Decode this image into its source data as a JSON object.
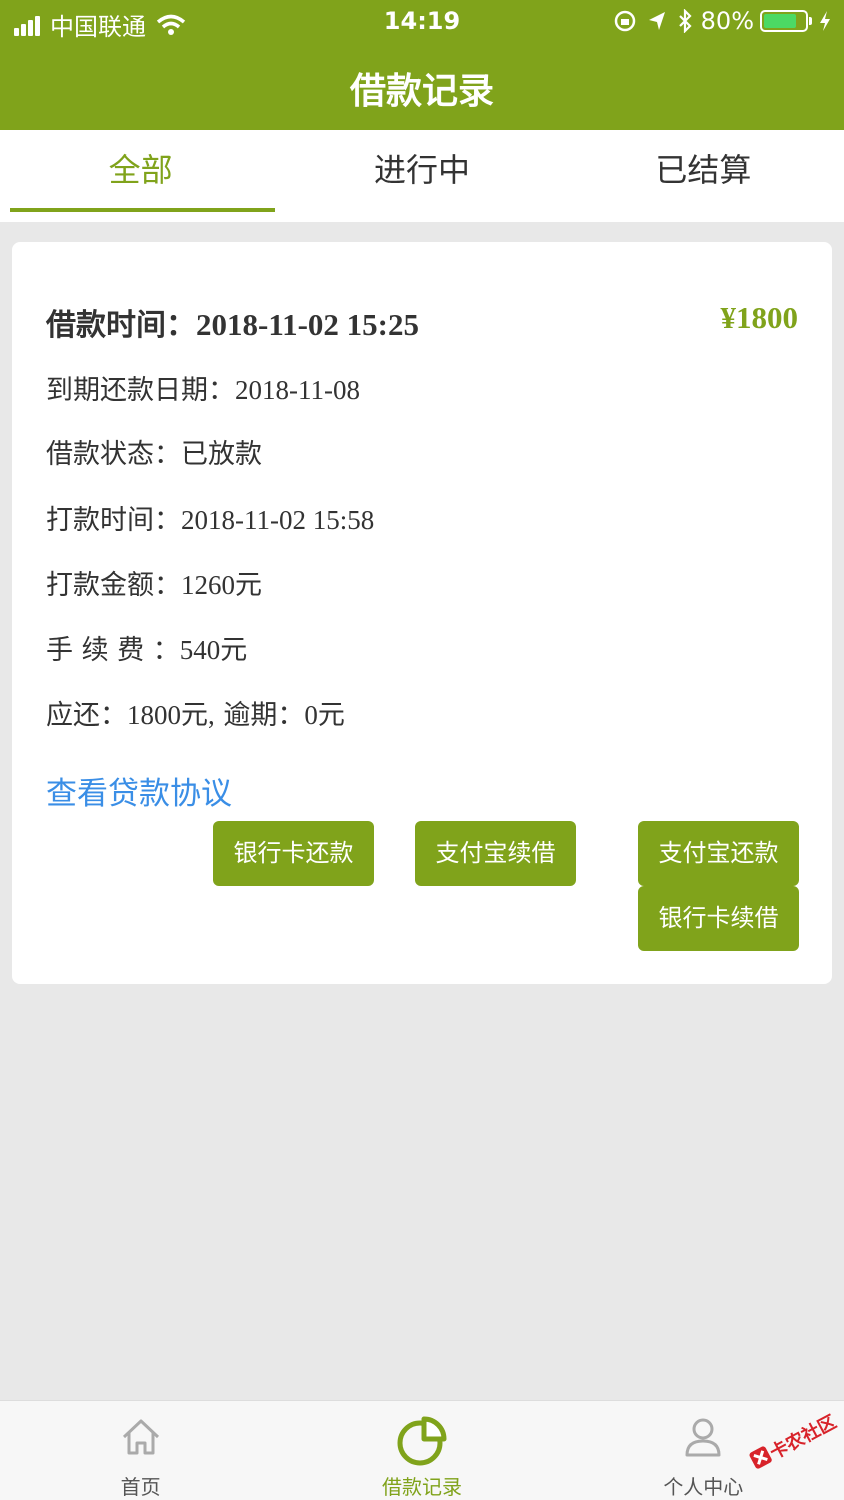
{
  "status_bar": {
    "carrier": "中国联通",
    "time": "14:19",
    "battery": "80%"
  },
  "header": {
    "title": "借款记录"
  },
  "tabs": [
    {
      "label": "全部",
      "active": true
    },
    {
      "label": "进行中",
      "active": false
    },
    {
      "label": "已结算",
      "active": false
    }
  ],
  "loan": {
    "borrow_time_label": "借款时间：",
    "borrow_time": "2018-11-02 15:25",
    "amount": "¥1800",
    "due_date_label": "到期还款日期：",
    "due_date": "2018-11-08",
    "status_label": "借款状态：",
    "status": "已放款",
    "payout_time_label": "打款时间：",
    "payout_time": "2018-11-02 15:58",
    "payout_amount_label": "打款金额：",
    "payout_amount": "1260元",
    "fee_label": "手 续 费 ：",
    "fee": "540元",
    "due_label": "应还：",
    "due_amount": "1800元,",
    "overdue_label": "逾期：",
    "overdue": "0元",
    "agreement_link": "查看贷款协议"
  },
  "actions": {
    "bank_repay": "银行卡还款",
    "alipay_renew": "支付宝续借",
    "alipay_repay": "支付宝还款",
    "bank_renew": "银行卡续借"
  },
  "tabbar": [
    {
      "label": "首页",
      "icon": "home-icon"
    },
    {
      "label": "借款记录",
      "icon": "pie-chart-icon",
      "active": true
    },
    {
      "label": "个人中心",
      "icon": "user-icon"
    }
  ],
  "watermark": "卡农社区",
  "colors": {
    "accent": "#80a31b",
    "link": "#3a8ee6",
    "background": "#e8e8e8"
  }
}
